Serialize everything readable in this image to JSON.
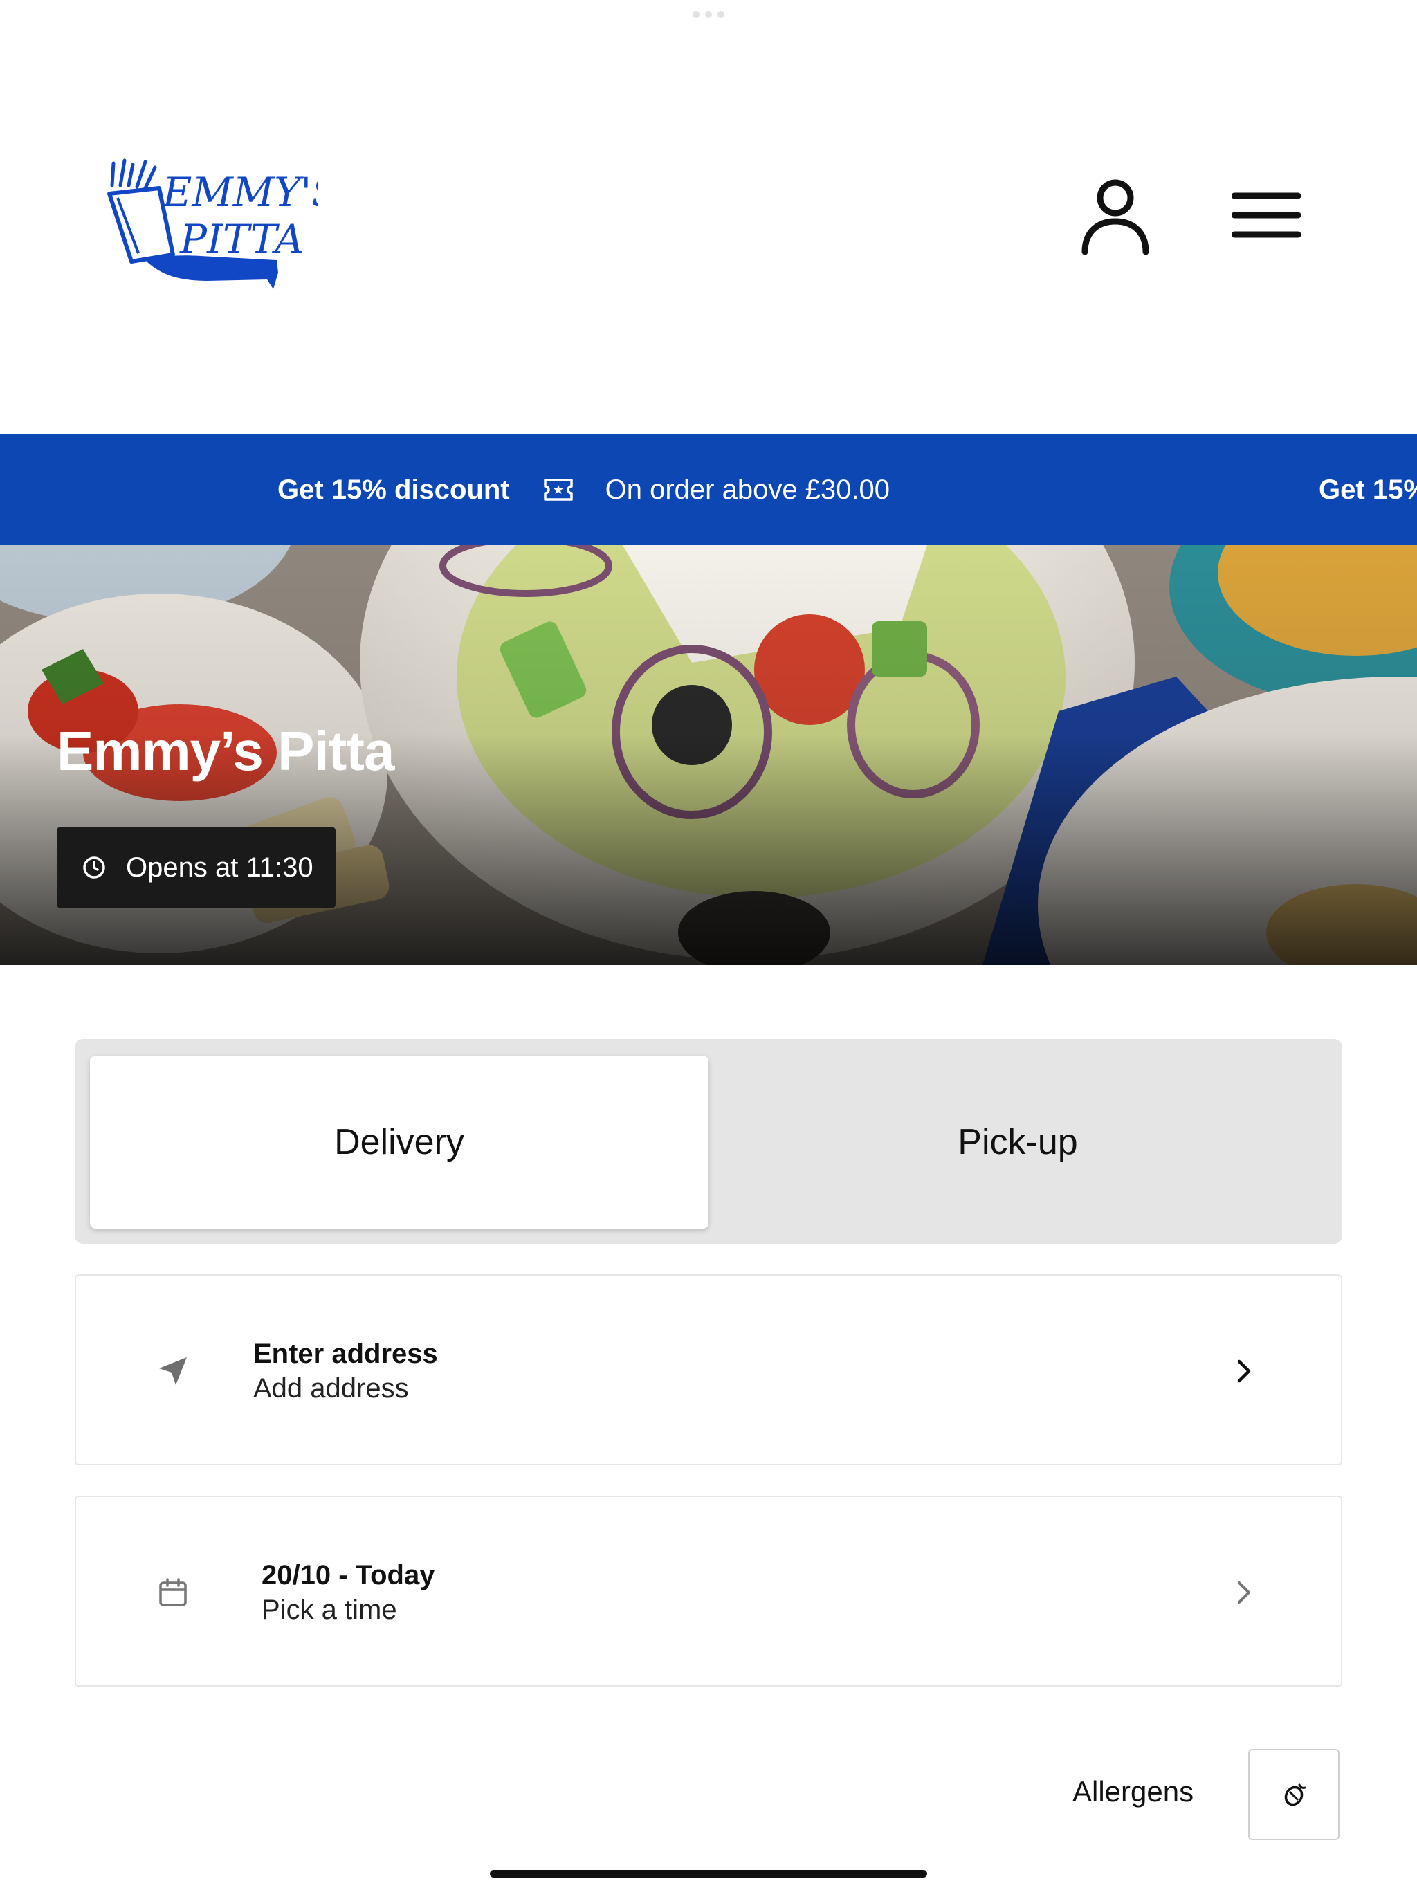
{
  "brand": {
    "logo_text_line1": "EMMY'S",
    "logo_text_line2": "PITTA",
    "logo_color": "#1147c4"
  },
  "header": {
    "account_icon": "user-icon",
    "menu_icon": "hamburger-menu-icon"
  },
  "promo": {
    "headline": "Get 15% discount",
    "detail": "On order above £30.00",
    "icon": "ticket-icon",
    "background": "#0d47b3"
  },
  "hero": {
    "restaurant_name": "Emmy’s Pitta",
    "hours_text": "Opens at 11:30",
    "hours_icon": "clock-icon"
  },
  "order_type": {
    "tabs": [
      {
        "label": "Delivery",
        "selected": true
      },
      {
        "label": "Pick-up",
        "selected": false
      }
    ]
  },
  "address_card": {
    "title": "Enter address",
    "subtitle": "Add address",
    "icon": "location-arrow-icon",
    "chevron": "chevron-right-icon"
  },
  "time_card": {
    "title": "20/10 - Today",
    "subtitle": "Pick a time",
    "icon": "calendar-icon",
    "chevron": "chevron-right-icon"
  },
  "allergens": {
    "label": "Allergens",
    "icon": "allergen-icon"
  }
}
